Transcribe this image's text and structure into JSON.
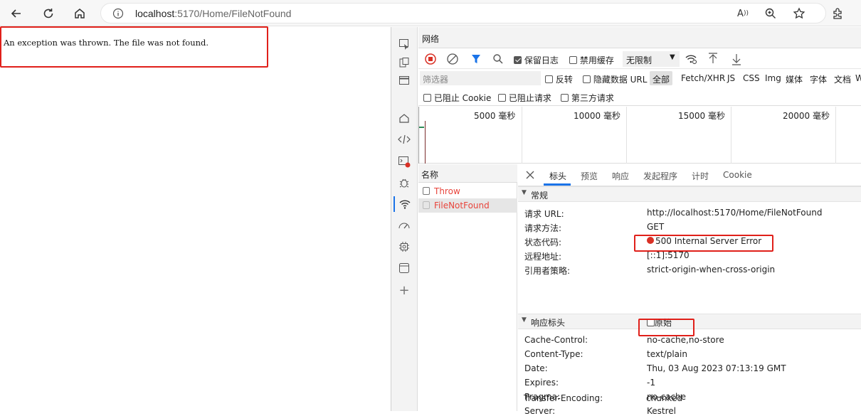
{
  "browser": {
    "url_host": "localhost",
    "url_rest": ":5170/Home/FileNotFound"
  },
  "page": {
    "message": "An exception was thrown. The file was not found."
  },
  "devtools": {
    "panel_title": "网络",
    "toolbar": {
      "preserve_log": "保留日志",
      "disable_cache": "禁用缓存",
      "throttle": "无限制"
    },
    "filter": {
      "placeholder": "筛选器",
      "invert": "反转",
      "hide_data_urls": "隐藏数据 URL",
      "types": [
        "全部",
        "Fetch/XHR",
        "JS",
        "CSS",
        "Img",
        "媒体",
        "字体",
        "文档",
        "W"
      ]
    },
    "filter2": {
      "blocked_cookies": "已阻止 Cookie",
      "blocked_requests": "已阻止请求",
      "third_party": "第三方请求"
    },
    "timeline": {
      "ticks": [
        "5000  毫秒",
        "10000  毫秒",
        "15000  毫秒",
        "20000  毫秒"
      ]
    },
    "requests": {
      "header": "名称",
      "items": [
        {
          "name": "Throw",
          "selected": false
        },
        {
          "name": "FileNotFound",
          "selected": true
        }
      ]
    },
    "detail": {
      "tabs": [
        "标头",
        "预览",
        "响应",
        "发起程序",
        "计时",
        "Cookie"
      ],
      "general_title": "常规",
      "general": [
        {
          "key": "请求 URL:",
          "value": "http://localhost:5170/Home/FileNotFound"
        },
        {
          "key": "请求方法:",
          "value": "GET"
        },
        {
          "key": "状态代码:",
          "value": "500 Internal Server Error"
        },
        {
          "key": "远程地址:",
          "value": "[::1]:5170"
        },
        {
          "key": "引用者策略:",
          "value": "strict-origin-when-cross-origin"
        }
      ],
      "response_title": "响应标头",
      "raw_label": "原始",
      "response_headers": [
        {
          "key": "Cache-Control:",
          "value": "no-cache,no-store"
        },
        {
          "key": "Content-Type:",
          "value": "text/plain"
        },
        {
          "key": "Date:",
          "value": "Thu, 03 Aug 2023 07:13:19 GMT"
        },
        {
          "key": "Expires:",
          "value": "-1"
        },
        {
          "key": "Pragma:",
          "value": "no-cache"
        },
        {
          "key": "Server:",
          "value": "Kestrel"
        },
        {
          "key": "Transfer-Encoding:",
          "value": "chunked"
        }
      ]
    }
  },
  "colors": {
    "highlight_box": "#e0201a",
    "error_text": "#e8453c",
    "accent_blue": "#1a73e8"
  }
}
